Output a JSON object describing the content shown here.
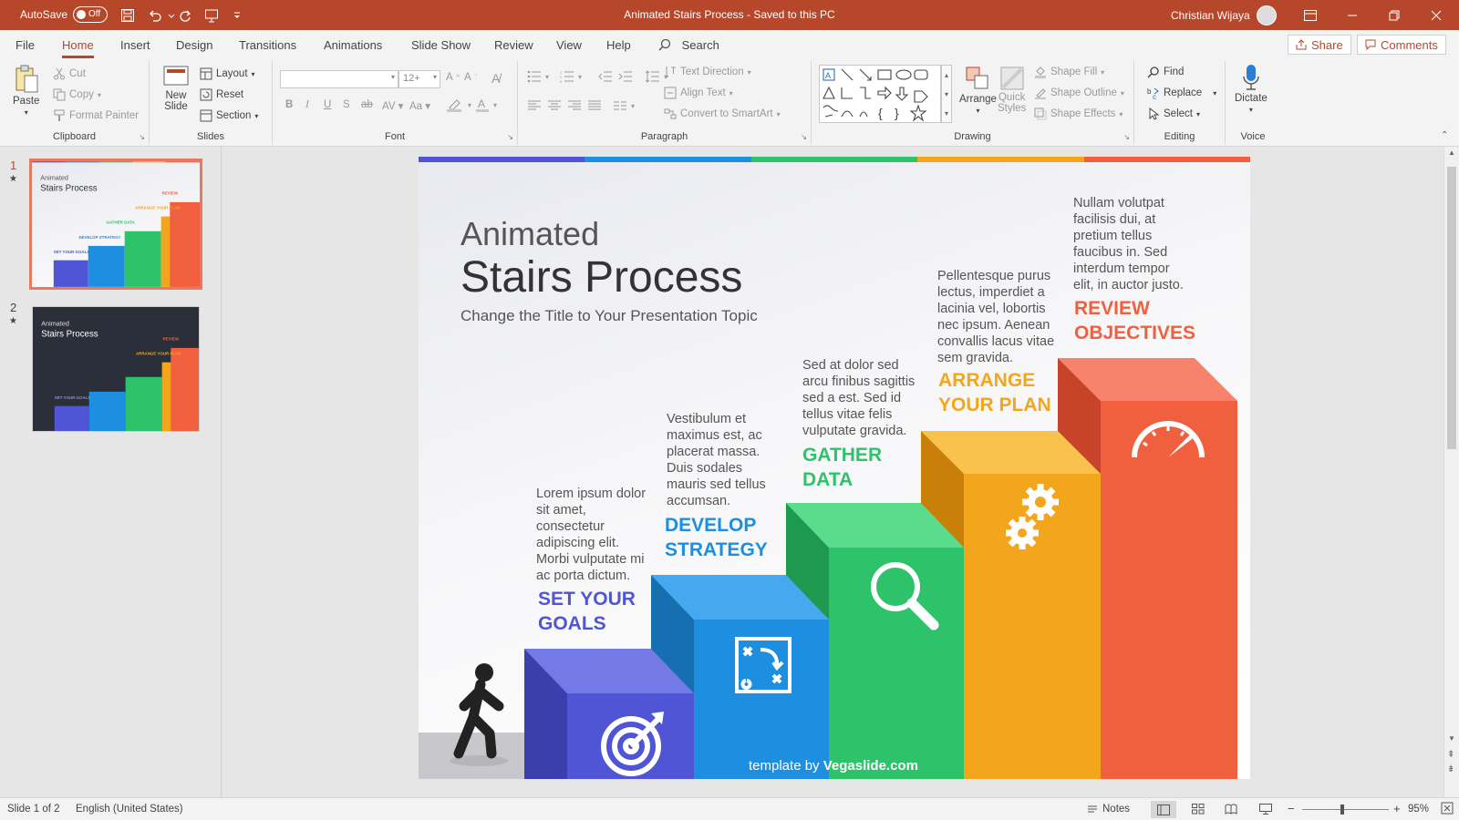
{
  "titlebar": {
    "autosave_label": "AutoSave",
    "autosave_state": "Off",
    "document_title": "Animated Stairs Process  -  Saved to this PC",
    "user_name": "Christian Wijaya"
  },
  "menu": {
    "tabs": [
      "File",
      "Home",
      "Insert",
      "Design",
      "Transitions",
      "Animations",
      "Slide Show",
      "Review",
      "View",
      "Help"
    ],
    "active_tab": "Home",
    "search_label": "Search",
    "share_label": "Share",
    "comments_label": "Comments"
  },
  "ribbon": {
    "clipboard": {
      "label": "Clipboard",
      "paste": "Paste",
      "cut": "Cut",
      "copy": "Copy",
      "format_painter": "Format Painter"
    },
    "slides": {
      "label": "Slides",
      "new_slide_1": "New",
      "new_slide_2": "Slide",
      "layout": "Layout",
      "reset": "Reset",
      "section": "Section"
    },
    "font": {
      "label": "Font",
      "font_name": "",
      "font_size": "12+"
    },
    "paragraph": {
      "label": "Paragraph",
      "text_direction": "Text Direction",
      "align_text": "Align Text",
      "convert_smartart": "Convert to SmartArt"
    },
    "drawing": {
      "label": "Drawing",
      "arrange": "Arrange",
      "quick_styles_1": "Quick",
      "quick_styles_2": "Styles",
      "shape_fill": "Shape Fill",
      "shape_outline": "Shape Outline",
      "shape_effects": "Shape Effects"
    },
    "editing": {
      "label": "Editing",
      "find": "Find",
      "replace": "Replace",
      "select": "Select"
    },
    "voice": {
      "label": "Voice",
      "dictate": "Dictate"
    }
  },
  "thumbnails": [
    {
      "number": "1",
      "star": "★",
      "active": true
    },
    {
      "number": "2",
      "star": "★",
      "active": false
    }
  ],
  "slide": {
    "title_line1": "Animated",
    "title_line2": "Stairs Process",
    "subtitle": "Change the Title to Your Presentation Topic",
    "steps": [
      {
        "heading_1": "SET YOUR",
        "heading_2": "GOALS",
        "color": "#5055d6",
        "body": [
          "Lorem ipsum dolor",
          "sit amet,",
          "consectetur",
          "adipiscing elit.",
          "Morbi vulputate mi",
          "ac porta dictum."
        ],
        "icon": "target-icon"
      },
      {
        "heading_1": "DEVELOP",
        "heading_2": "STRATEGY",
        "color": "#1e8fe0",
        "body": [
          "Vestibulum et",
          "maximus est, ac",
          "placerat massa.",
          "Duis sodales",
          "mauris sed tellus",
          "accumsan."
        ],
        "icon": "strategy-icon"
      },
      {
        "heading_1": "GATHER",
        "heading_2": "DATA",
        "color": "#2ec26a",
        "body": [
          "Sed at dolor sed",
          "arcu finibus sagittis",
          "sed a est. Sed id",
          "tellus vitae felis",
          "vulputate gravida."
        ],
        "icon": "magnifier-icon"
      },
      {
        "heading_1": "ARRANGE",
        "heading_2": "YOUR PLAN",
        "color": "#f3a51c",
        "body": [
          "Pellentesque purus",
          "lectus, imperdiet a",
          "lacinia vel, lobortis",
          "nec ipsum. Aenean",
          "convallis lacus vitae",
          "sem gravida."
        ],
        "icon": "gears-icon"
      },
      {
        "heading_1": "REVIEW",
        "heading_2": "OBJECTIVES",
        "color": "#f0603e",
        "body": [
          "Nullam volutpat",
          "facilisis dui, at",
          "pretium tellus",
          "faucibus in. Sed",
          "interdum tempor",
          "elit, in auctor justo."
        ],
        "icon": "gauge-icon"
      }
    ],
    "credit_prefix": "template by ",
    "credit_brand": "Vegaslide.com"
  },
  "status": {
    "slide_count": "Slide 1 of 2",
    "language": "English (United States)",
    "notes": "Notes",
    "zoom": "95%"
  },
  "colors": {
    "accent": "#b7472a",
    "rainbow": [
      "#5055d6",
      "#1e8fe0",
      "#2ec26a",
      "#f3a51c",
      "#f0603e"
    ]
  }
}
